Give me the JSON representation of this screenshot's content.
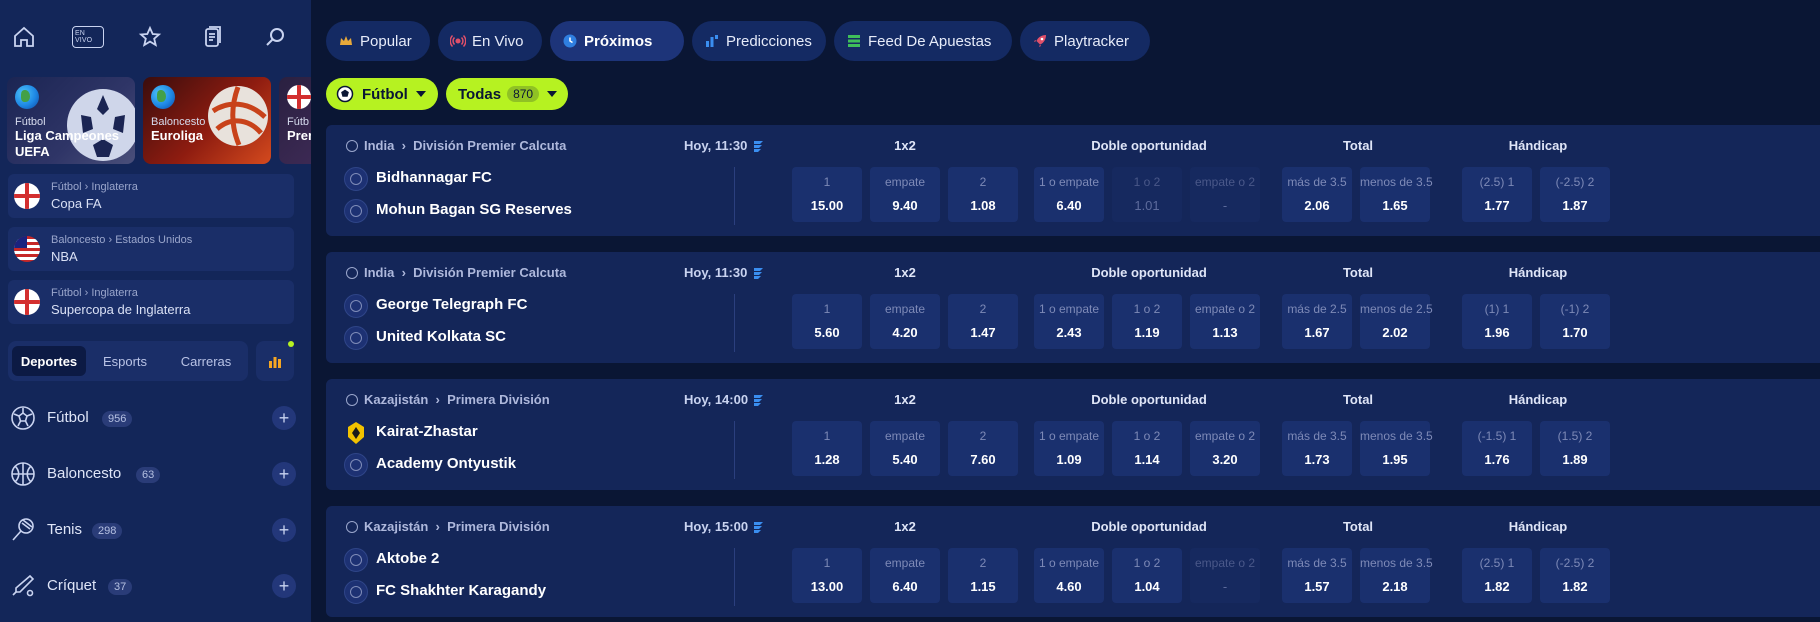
{
  "sidebar": {
    "top_icons": [
      {
        "name": "home-icon"
      },
      {
        "name": "en-vivo-icon",
        "label": "EN VIVO"
      },
      {
        "name": "star-icon"
      },
      {
        "name": "betslip-icon"
      },
      {
        "name": "search-icon"
      }
    ],
    "promos": [
      {
        "sport": "Fútbol",
        "league": "Liga Campeones UEFA",
        "l1": "Liga Campeones",
        "l2": "UEFA"
      },
      {
        "sport": "Baloncesto",
        "league": "Euroliga",
        "l1": "Euroliga",
        "l2": ""
      },
      {
        "sport": "Fútb",
        "league": "Prem",
        "l1": "Prem",
        "l2": ""
      }
    ],
    "favorites": [
      {
        "sub": "Fútbol › Inglaterra",
        "name": "Copa FA",
        "flag": "england"
      },
      {
        "sub": "Baloncesto › Estados Unidos",
        "name": "NBA",
        "flag": "usa"
      },
      {
        "sub": "Fútbol › Inglaterra",
        "name": "Supercopa de Inglaterra",
        "flag": "england"
      }
    ],
    "segment": [
      "Deportes",
      "Esports",
      "Carreras"
    ],
    "segment_active": "Deportes",
    "sports": [
      {
        "name": "Fútbol",
        "count": "956",
        "icon": "soccer-ball-icon"
      },
      {
        "name": "Baloncesto",
        "count": "63",
        "icon": "basketball-icon"
      },
      {
        "name": "Tenis",
        "count": "298",
        "icon": "tennis-racket-icon"
      },
      {
        "name": "Críquet",
        "count": "37",
        "icon": "cricket-bat-icon"
      }
    ]
  },
  "tabs": [
    {
      "label": "Popular",
      "icon": "crown-icon",
      "active": false
    },
    {
      "label": "En Vivo",
      "icon": "live-signal-icon",
      "active": false
    },
    {
      "label": "Próximos",
      "icon": "clock-icon",
      "active": true
    },
    {
      "label": "Predicciones",
      "icon": "bars-icon",
      "active": false
    },
    {
      "label": "Feed De Apuestas",
      "icon": "feed-icon",
      "active": false
    },
    {
      "label": "Playtracker",
      "icon": "rocket-icon",
      "active": false
    }
  ],
  "filters": {
    "sport": "Fútbol",
    "all_label": "Todas",
    "all_count": "870"
  },
  "market_headers": {
    "m1x2": "1x2",
    "double": "Doble oportunidad",
    "total": "Total",
    "handicap": "Hándicap"
  },
  "matches": [
    {
      "country": "India",
      "league": "División Premier Calcuta",
      "time": "Hoy, 11:30",
      "home": "Bidhannagar FC",
      "away": "Mohun Bagan SG Reserves",
      "odds": [
        {
          "label": "1",
          "value": "15.00"
        },
        {
          "label": "empate",
          "value": "9.40"
        },
        {
          "label": "2",
          "value": "1.08"
        },
        {
          "label": "1 o empate",
          "value": "6.40"
        },
        {
          "label": "1 o 2",
          "value": "1.01",
          "dim": true
        },
        {
          "label": "empate o 2",
          "value": "-",
          "dim": true
        },
        {
          "label": "más de 3.5",
          "value": "2.06"
        },
        {
          "label": "menos de 3.5",
          "value": "1.65"
        },
        {
          "label": "(2.5) 1",
          "value": "1.77"
        },
        {
          "label": "(-2.5) 2",
          "value": "1.87"
        }
      ]
    },
    {
      "country": "India",
      "league": "División Premier Calcuta",
      "time": "Hoy, 11:30",
      "home": "George Telegraph FC",
      "away": "United Kolkata SC",
      "odds": [
        {
          "label": "1",
          "value": "5.60"
        },
        {
          "label": "empate",
          "value": "4.20"
        },
        {
          "label": "2",
          "value": "1.47"
        },
        {
          "label": "1 o empate",
          "value": "2.43"
        },
        {
          "label": "1 o 2",
          "value": "1.19"
        },
        {
          "label": "empate o 2",
          "value": "1.13"
        },
        {
          "label": "más de 2.5",
          "value": "1.67"
        },
        {
          "label": "menos de 2.5",
          "value": "2.02"
        },
        {
          "label": "(1) 1",
          "value": "1.96"
        },
        {
          "label": "(-1) 2",
          "value": "1.70"
        }
      ]
    },
    {
      "country": "Kazajistán",
      "league": "Primera División",
      "time": "Hoy, 14:00",
      "home": "Kairat-Zhastar",
      "away": "Academy Ontyustik",
      "home_logo": "kairat",
      "odds": [
        {
          "label": "1",
          "value": "1.28"
        },
        {
          "label": "empate",
          "value": "5.40"
        },
        {
          "label": "2",
          "value": "7.60"
        },
        {
          "label": "1 o empate",
          "value": "1.09"
        },
        {
          "label": "1 o 2",
          "value": "1.14"
        },
        {
          "label": "empate o 2",
          "value": "3.20"
        },
        {
          "label": "más de 3.5",
          "value": "1.73"
        },
        {
          "label": "menos de 3.5",
          "value": "1.95"
        },
        {
          "label": "(-1.5) 1",
          "value": "1.76"
        },
        {
          "label": "(1.5) 2",
          "value": "1.89"
        }
      ]
    },
    {
      "country": "Kazajistán",
      "league": "Primera División",
      "time": "Hoy, 15:00",
      "home": "Aktobe 2",
      "away": "FC Shakhter Karagandy",
      "odds": [
        {
          "label": "1",
          "value": "13.00"
        },
        {
          "label": "empate",
          "value": "6.40"
        },
        {
          "label": "2",
          "value": "1.15"
        },
        {
          "label": "1 o empate",
          "value": "4.60"
        },
        {
          "label": "1 o 2",
          "value": "1.04"
        },
        {
          "label": "empate o 2",
          "value": "-",
          "dim": true
        },
        {
          "label": "más de 3.5",
          "value": "1.57"
        },
        {
          "label": "menos de 3.5",
          "value": "2.18"
        },
        {
          "label": "(2.5) 1",
          "value": "1.82"
        },
        {
          "label": "(-2.5) 2",
          "value": "1.82"
        }
      ]
    }
  ],
  "colors": {
    "accent": "#b6f221",
    "bg": "#0a1634",
    "sidebar": "#132659",
    "card": "#142659"
  }
}
